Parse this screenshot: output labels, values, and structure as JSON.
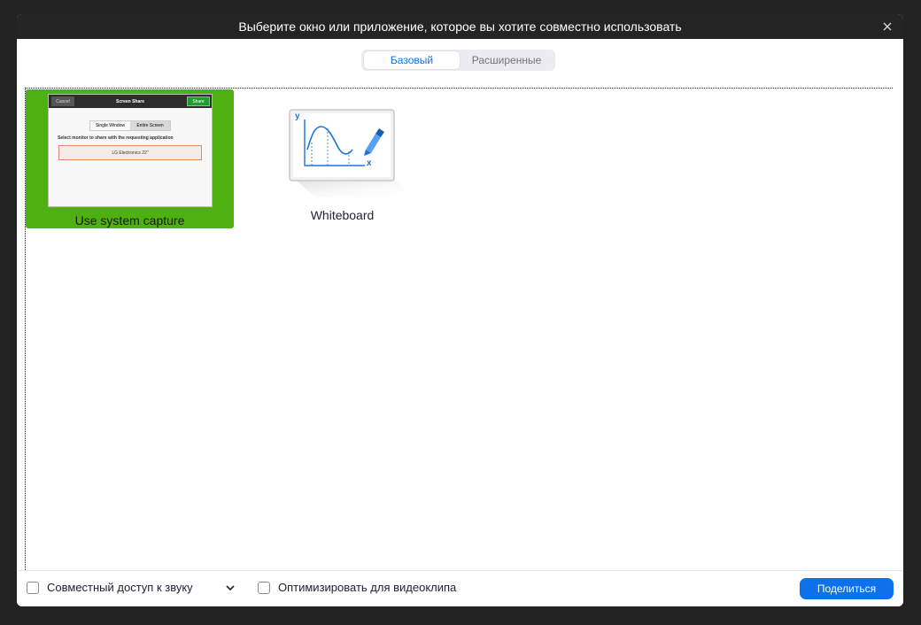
{
  "dialog": {
    "title": "Выберите окно или приложение, которое вы хотите совместно использовать",
    "close_icon": "close-icon"
  },
  "tabs": [
    {
      "label": "Базовый",
      "active": true
    },
    {
      "label": "Расширенные",
      "active": false
    }
  ],
  "tiles": {
    "system_capture": {
      "label": "Use system capture",
      "thumbnail": {
        "cancel": "Cancel",
        "title": "Screen Share",
        "share": "Share",
        "segment_1": "Single Window",
        "segment_2": "Entire Screen",
        "instruction": "Select monitor to share with the requesting application",
        "monitor": "LG Electronics 22\""
      }
    },
    "whiteboard": {
      "label": "Whiteboard",
      "axis_y": "y",
      "axis_x": "x"
    }
  },
  "footer": {
    "share_sound_label": "Совместный доступ к звуку",
    "optimize_video_label": "Оптимизировать для видеоклипа",
    "share_button": "Поделиться"
  },
  "colors": {
    "accent": "#0e71eb",
    "selected_tile": "#4fb012",
    "titlebar": "#242424"
  }
}
